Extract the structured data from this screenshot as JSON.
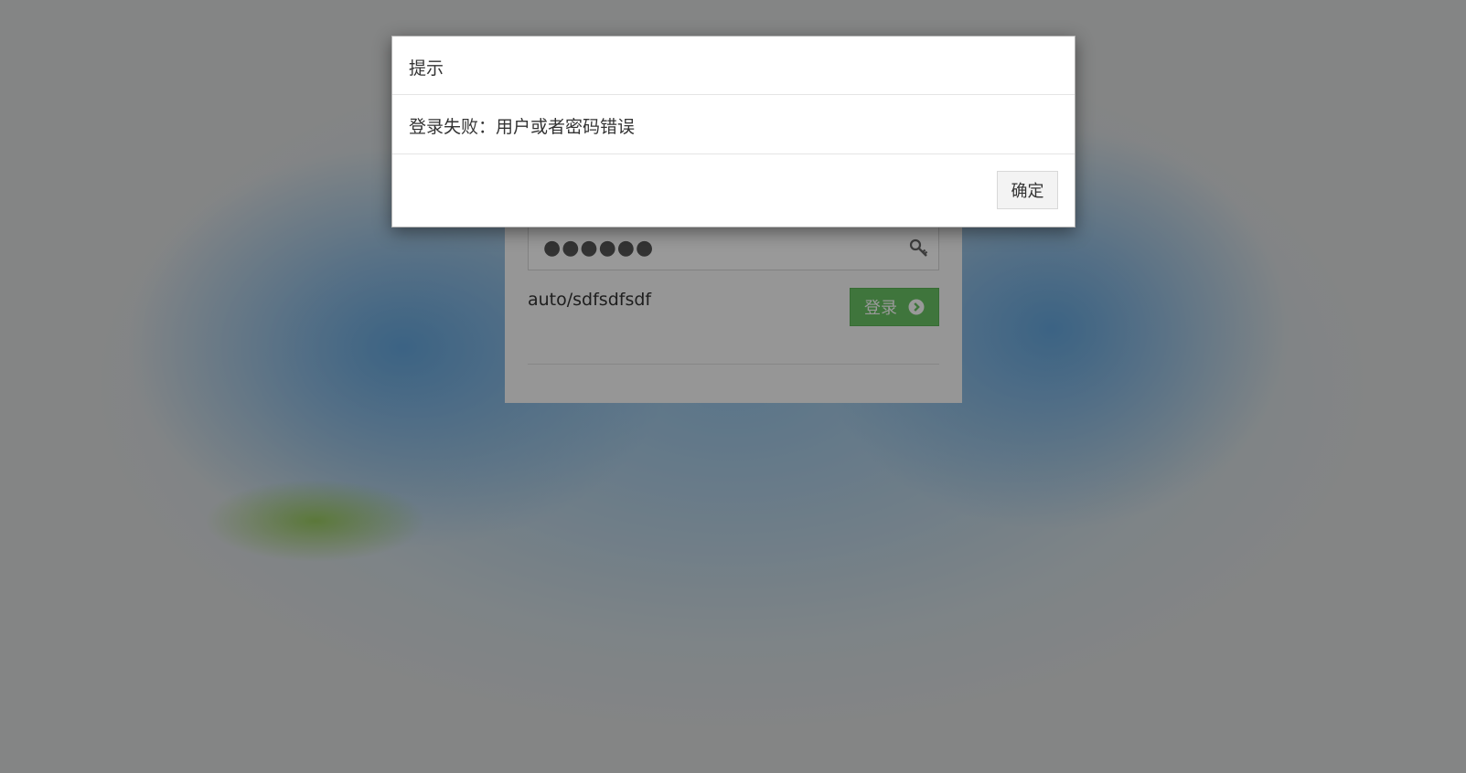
{
  "login": {
    "password_masked": "●●●●●●",
    "info_text": "auto/sdfsdfsdf",
    "login_button_label": "登录"
  },
  "dialog": {
    "title": "提示",
    "message": "登录失败：用户或者密码错误",
    "ok_button_label": "确定"
  },
  "colors": {
    "login_button": "#69c464",
    "overlay": "rgba(0,0,0,0.4)"
  },
  "icons": {
    "password_field": "key-icon",
    "login_button": "chevron-circle-right-icon"
  }
}
